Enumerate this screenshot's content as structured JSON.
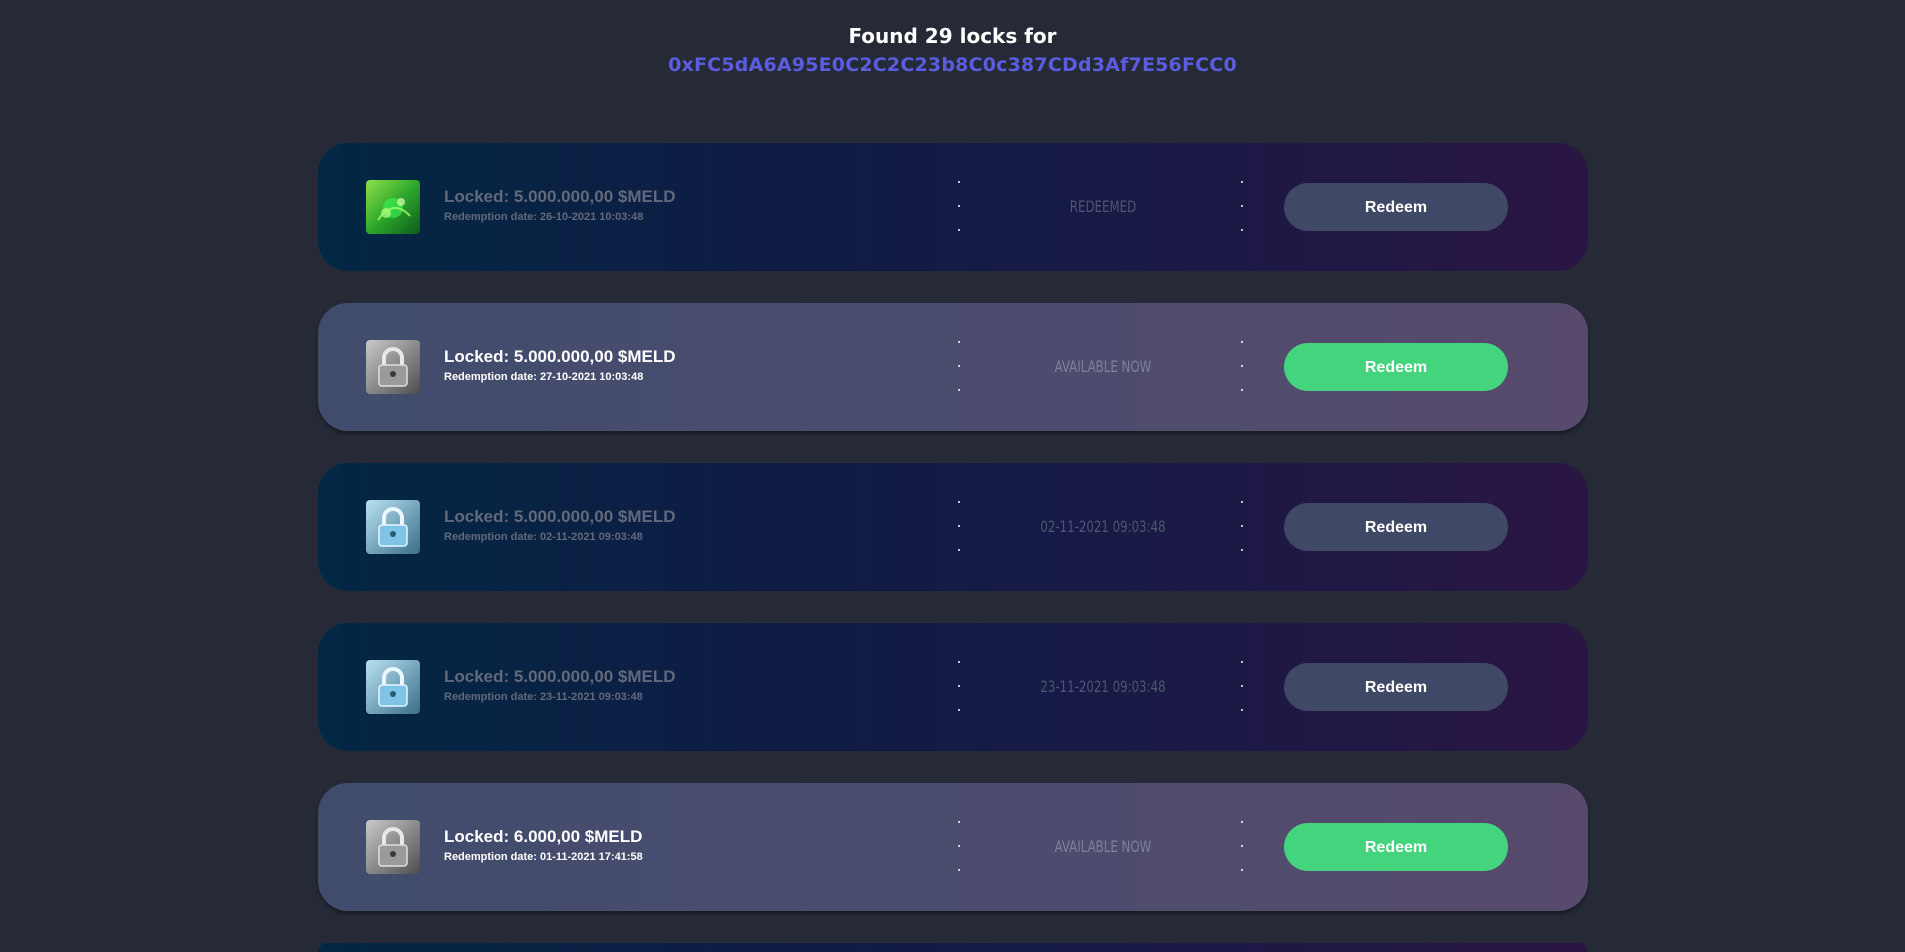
{
  "header": {
    "title": "Found 29 locks for",
    "address": "0xFC5dA6A95E0C2C2C23b8C0c387CDd3Af7E56FCC0"
  },
  "colors": {
    "background": "#252a36",
    "address_accent": "#5b5ce0",
    "redeem_active": "#45d47e",
    "redeem_inactive": "#3f4864"
  },
  "locks": [
    {
      "amount": "Locked: 5.000.000,00 $MELD",
      "date": "Redemption date: 26-10-2021 10:03:48",
      "status": "REDEEMED",
      "button": "Redeem",
      "icon": "green-meld-token-icon",
      "state": "redeemed"
    },
    {
      "amount": "Locked: 5.000.000,00 $MELD",
      "date": "Redemption date: 27-10-2021 10:03:48",
      "status": "AVAILABLE NOW",
      "button": "Redeem",
      "icon": "padlock-icon",
      "state": "available"
    },
    {
      "amount": "Locked: 5.000.000,00 $MELD",
      "date": "Redemption date: 02-11-2021 09:03:48",
      "status": "02-11-2021 09:03:48",
      "button": "Redeem",
      "icon": "blue-padlock-icon",
      "state": "locked"
    },
    {
      "amount": "Locked: 5.000.000,00 $MELD",
      "date": "Redemption date: 23-11-2021 09:03:48",
      "status": "23-11-2021 09:03:48",
      "button": "Redeem",
      "icon": "blue-padlock-icon",
      "state": "locked"
    },
    {
      "amount": "Locked: 6.000,00 $MELD",
      "date": "Redemption date: 01-11-2021 17:41:58",
      "status": "AVAILABLE NOW",
      "button": "Redeem",
      "icon": "padlock-icon",
      "state": "available"
    }
  ]
}
